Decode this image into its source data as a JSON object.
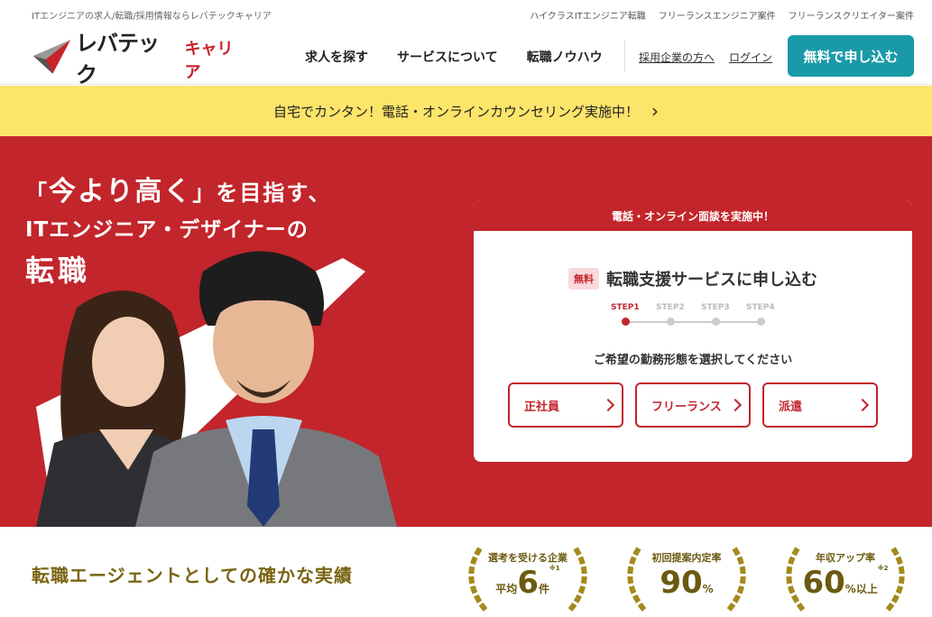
{
  "util": {
    "tagline": "ITエンジニアの求人/転職/採用情報ならレバテックキャリア",
    "links": [
      "ハイクラスITエンジニア転職",
      "フリーランスエンジニア案件",
      "フリーランスクリエイター案件"
    ]
  },
  "header": {
    "logo_main": "レバテック",
    "logo_sub": "キャリア",
    "nav": [
      "求人を探す",
      "サービスについて",
      "転職ノウハウ"
    ],
    "sublinks": [
      "採用企業の方へ",
      "ログイン"
    ],
    "cta": "無料で申し込む"
  },
  "banner": {
    "text": "自宅でカンタン！電話・オンラインカウンセリング実施中！",
    "arrow": "›"
  },
  "hero": {
    "line1_quote_open": "「",
    "line1_main": "今より高く",
    "line1_quote_close": "」",
    "line1_rest": "を目指す、",
    "line2": "ITエンジニア・デザイナーの",
    "line3": "転職"
  },
  "card": {
    "header": "電話・オンライン面談を実施中！",
    "badge": "無料",
    "title": "転職支援サービスに申し込む",
    "steps": [
      "STEP1",
      "STEP2",
      "STEP3",
      "STEP4"
    ],
    "active_step": 1,
    "prompt": "ご希望の勤務形態を選択してください",
    "options": [
      "正社員",
      "フリーランス",
      "派遣"
    ]
  },
  "stats": {
    "title": "転職エージェントとしての確かな実績",
    "awards": [
      {
        "label": "選考を受ける企業",
        "prefix": "平均",
        "value": "6",
        "unit": "件",
        "note": "※1"
      },
      {
        "label": "初回提案内定率",
        "prefix": "",
        "value": "90",
        "unit": "%",
        "note": ""
      },
      {
        "label": "年収アップ率",
        "prefix": "",
        "value": "60",
        "unit": "%以上",
        "note": "※2"
      }
    ]
  },
  "colors": {
    "brand_red": "#c2252b",
    "teal": "#1a9aa8",
    "banner_yellow": "#fde46b",
    "gold": "#6b5a10"
  }
}
